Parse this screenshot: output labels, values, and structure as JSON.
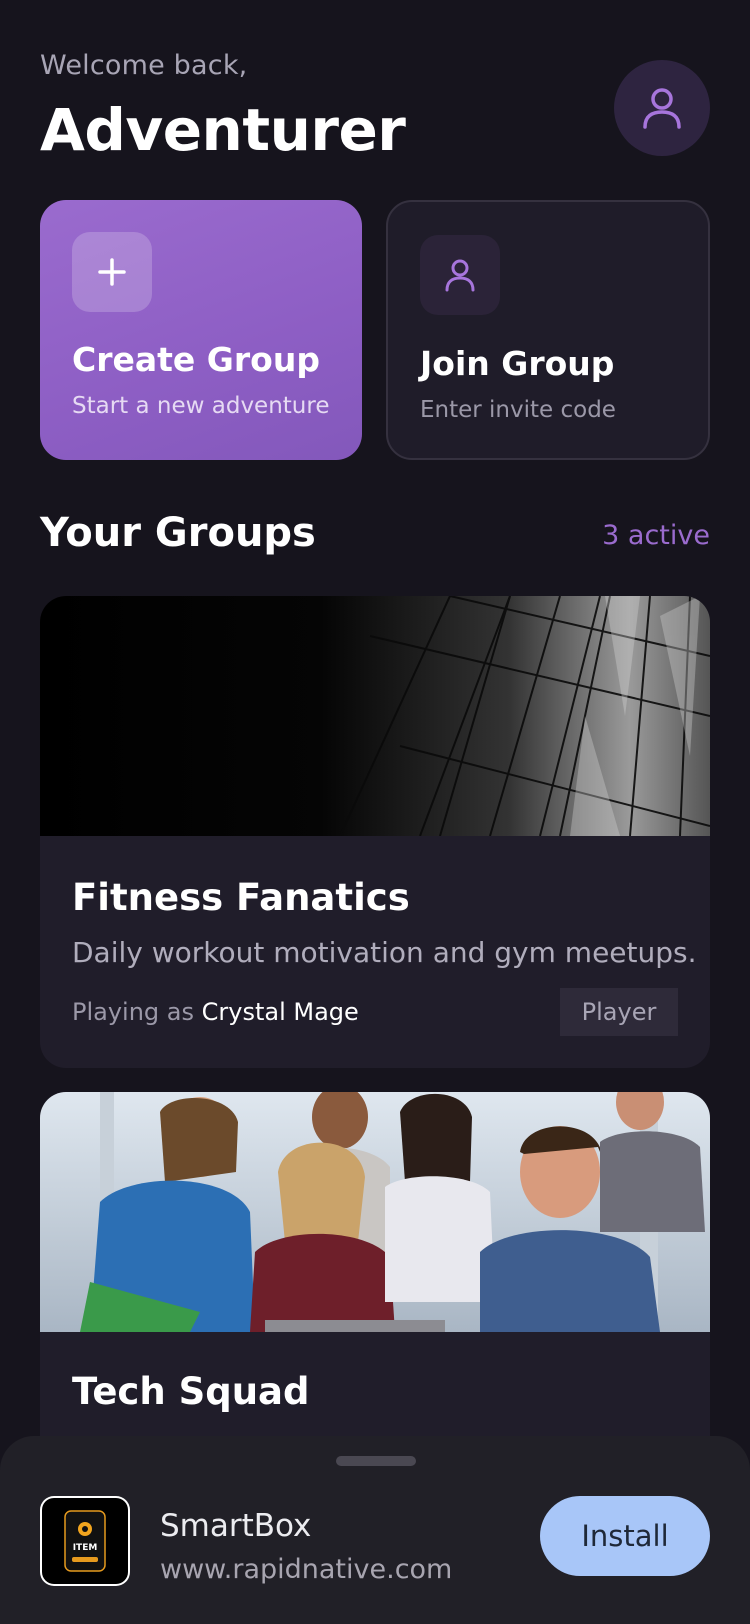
{
  "header": {
    "greeting": "Welcome back,",
    "name": "Adventurer",
    "avatar_icon": "user-icon"
  },
  "actions": {
    "create": {
      "icon": "plus-icon",
      "title": "Create Group",
      "subtitle": "Start a new adventure"
    },
    "join": {
      "icon": "user-icon",
      "title": "Join Group",
      "subtitle": "Enter invite code"
    }
  },
  "groups_section": {
    "title": "Your Groups",
    "count": "3 active"
  },
  "groups": [
    {
      "name": "Fitness Fanatics",
      "description": "Daily workout motivation and gym meetups.",
      "playing_as_prefix": "Playing as ",
      "character": "Crystal Mage",
      "role": "Player"
    },
    {
      "name": "Tech Squad"
    }
  ],
  "install_sheet": {
    "app_name": "SmartBox",
    "app_url": "www.rapidnative.com",
    "button": "Install",
    "icon_text": "ITEM"
  },
  "colors": {
    "background": "#16141d",
    "accent": "#9a6bce",
    "card": "#201d2a",
    "install": "#a8c6f8"
  }
}
